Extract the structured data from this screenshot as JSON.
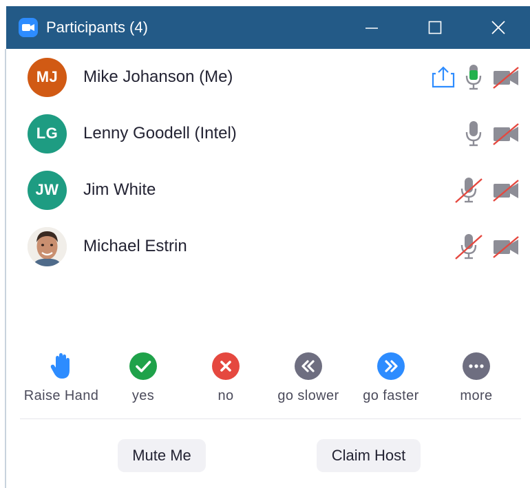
{
  "window": {
    "title": "Participants (4)",
    "app_icon": "zoom-camera-icon",
    "controls": [
      "minimize-icon",
      "maximize-icon",
      "close-icon"
    ],
    "titlebar_color": "#235a87"
  },
  "participants": [
    {
      "initials": "MJ",
      "name": "Mike Johanson (Me)",
      "avatar_color": "#d15a14",
      "sharing": true,
      "mic": "on",
      "video": "off"
    },
    {
      "initials": "LG",
      "name": "Lenny Goodell (Intel)",
      "avatar_color": "#1e9c82",
      "sharing": false,
      "mic": "idle",
      "video": "off"
    },
    {
      "initials": "JW",
      "name": "Jim White",
      "avatar_color": "#1e9c82",
      "sharing": false,
      "mic": "muted",
      "video": "off"
    },
    {
      "initials": "",
      "name": "Michael Estrin",
      "avatar_color": "photo",
      "sharing": false,
      "mic": "muted",
      "video": "off"
    }
  ],
  "reactions": [
    {
      "label": "Raise Hand",
      "icon": "raise-hand-icon",
      "color": "#2d8cff"
    },
    {
      "label": "yes",
      "icon": "check-icon",
      "color": "#1fa24a"
    },
    {
      "label": "no",
      "icon": "x-icon",
      "color": "#e5483f"
    },
    {
      "label": "go slower",
      "icon": "rewind-icon",
      "color": "#6e6e80"
    },
    {
      "label": "go faster",
      "icon": "fast-forward-icon",
      "color": "#2d8cff"
    },
    {
      "label": "more",
      "icon": "more-dots-icon",
      "color": "#6e6e80"
    }
  ],
  "actions": {
    "mute_me": "Mute Me",
    "claim_host": "Claim Host"
  }
}
